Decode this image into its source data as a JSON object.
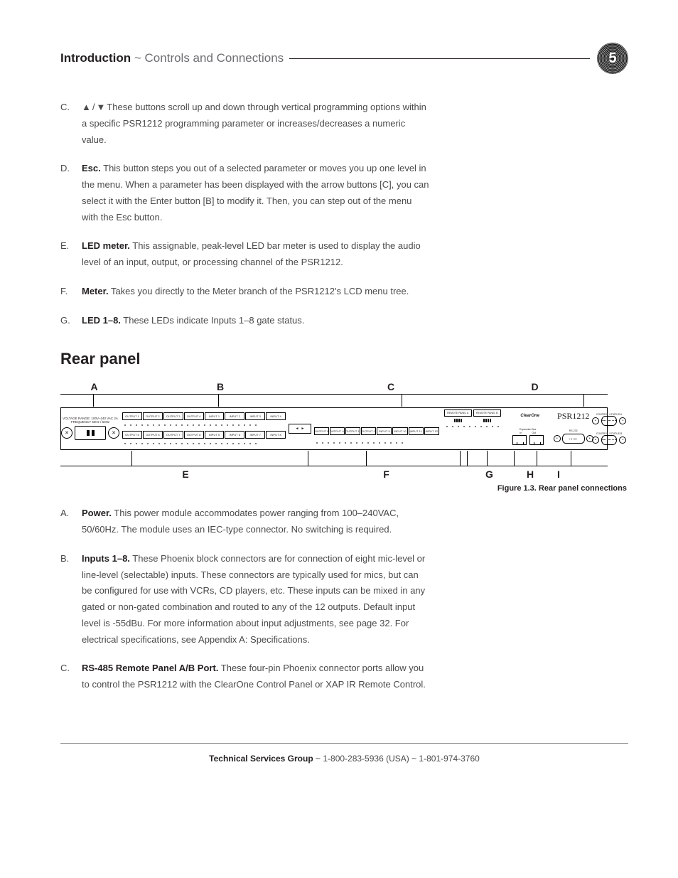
{
  "header": {
    "title_bold": "Introduction",
    "title_sep": " ~ ",
    "title_light": "Controls and Connections",
    "page_num": "5"
  },
  "list_top": {
    "c": {
      "letter": "C.",
      "arrows": "▲/▼",
      "text": "These buttons scroll up and down through vertical programming options within a specific PSR1212 programming parameter or increases/decreases a numeric value."
    },
    "d": {
      "letter": "D.",
      "bold": "Esc.",
      "text": " This button steps you out of a selected parameter or moves you up one level in the menu. When a parameter has been displayed with the arrow buttons [C], you can select it with the Enter button [B] to modify it. Then, you can step out of the menu with the Esc button."
    },
    "e": {
      "letter": "E.",
      "bold": "LED meter.",
      "text": " This assignable, peak-level LED bar meter is used to display the audio level of an input, output, or processing channel of the PSR1212."
    },
    "f": {
      "letter": "F.",
      "bold": "Meter.",
      "text": " Takes you directly to the Meter branch of the PSR1212's LCD menu tree."
    },
    "g": {
      "letter": "G.",
      "bold": "LED 1–8.",
      "text": " These LEDs indicate Inputs 1–8 gate status."
    }
  },
  "section_heading": "Rear panel",
  "diagram": {
    "labels_top": {
      "A": "A",
      "B": "B",
      "C": "C",
      "D": "D"
    },
    "labels_bot": {
      "E": "E",
      "F": "F",
      "G": "G",
      "H": "H",
      "I": "I"
    },
    "power_text": "VOLTAGE RANGE: 100V–240 VAC 2A\nFREQUENCY 50Hz / 60Hz",
    "out_row": [
      "OUTPUT 1",
      "OUTPUT 2",
      "OUTPUT 3",
      "OUTPUT 4",
      "INPUT 1",
      "INPUT 2",
      "INPUT 3",
      "INPUT 4"
    ],
    "out_row2": [
      "OUTPUT 5",
      "OUTPUT 6",
      "OUTPUT 7",
      "OUTPUT 8",
      "INPUT 5",
      "INPUT 6",
      "INPUT 7",
      "INPUT 8"
    ],
    "io_row": [
      "OUTPUT 9",
      "OUTPUT 10",
      "OUTPUT 11",
      "OUTPUT 12",
      "INPUT 9",
      "INPUT 10",
      "INPUT 11",
      "INPUT 12"
    ],
    "remote_a": "REMOTE PANEL A",
    "remote_b": "REMOTE PANEL B",
    "brand_co": "ClearOne",
    "brand_model": "PSR1212",
    "expbus": "Expansion Bus",
    "expbus_in": "In",
    "expbus_out": "Out",
    "rs232": "RS-232",
    "ctrl_a": "CONTROL / STATUS A",
    "ctrl_b": "CONTROL / STATUS B",
    "caption": "Figure 1.3. Rear panel connections"
  },
  "list_bot": {
    "a": {
      "letter": "A.",
      "bold": "Power.",
      "text": " This power module accommodates power ranging from 100–240VAC, 50/60Hz. The module uses an IEC-type connector. No switching is required."
    },
    "b": {
      "letter": "B.",
      "bold": "Inputs 1–8.",
      "text": " These Phoenix block connectors are for connection of eight mic-level or line-level (selectable) inputs. These connectors are typically used for mics, but can be configured for use with VCRs, CD players, etc. These inputs can be mixed in any gated or non-gated combination and routed to any of the 12 outputs. Default input level is -55dBu. For more information about input adjustments, see page 32. For electrical specifications, see Appendix A: Specifications."
    },
    "c": {
      "letter": "C.",
      "bold": "RS-485 Remote Panel A/B Port.",
      "text": " These four-pin Phoenix connector ports allow you to control the PSR1212 with the ClearOne Control Panel or XAP IR Remote Control."
    }
  },
  "footer": {
    "bold": "Technical Services Group",
    "rest": " ~ 1-800-283-5936 (USA) ~ 1-801-974-3760"
  }
}
